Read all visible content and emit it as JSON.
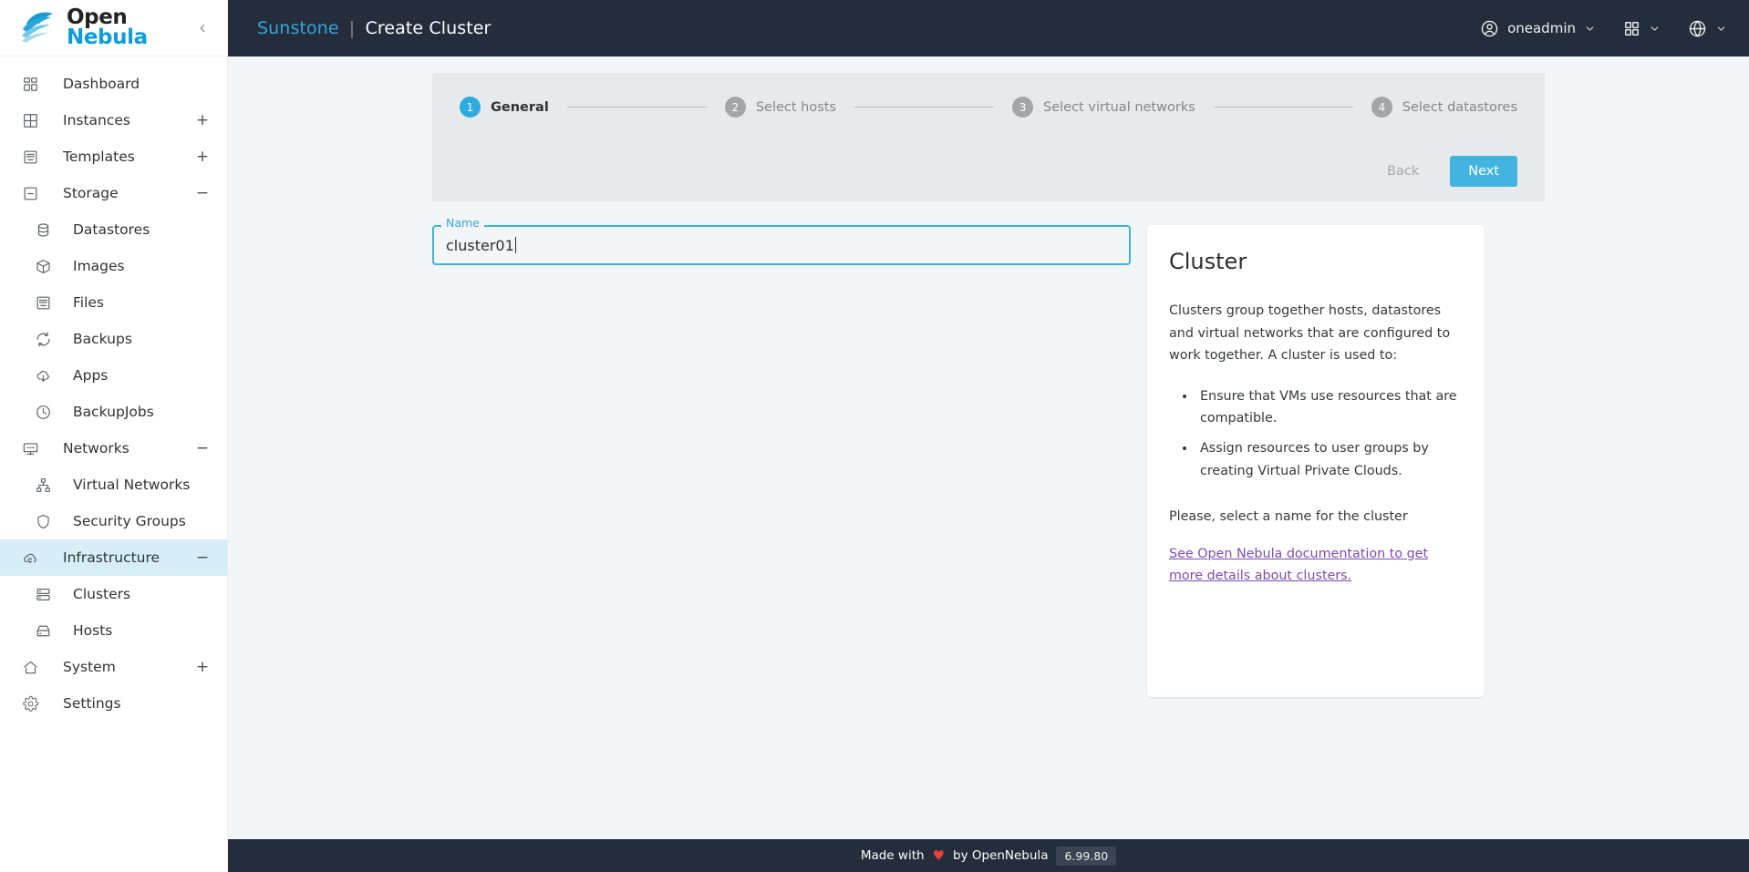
{
  "brand": {
    "name_line1": "Open",
    "name_line2": "Nebula",
    "logo_icon": "opennebula-cloud-logo",
    "collapse_icon": "chevron-left-icon"
  },
  "sidebar": {
    "items": [
      {
        "label": "Dashboard",
        "icon": "dashboard-grid-icon",
        "level": "root",
        "toggle": "",
        "active": false
      },
      {
        "label": "Instances",
        "icon": "instances-grid-icon",
        "level": "root",
        "toggle": "+",
        "active": false
      },
      {
        "label": "Templates",
        "icon": "templates-icon",
        "level": "root",
        "toggle": "+",
        "active": false
      },
      {
        "label": "Storage",
        "icon": "storage-icon",
        "level": "root",
        "toggle": "−",
        "active": false
      },
      {
        "label": "Datastores",
        "icon": "datastore-icon",
        "level": "child",
        "toggle": "",
        "active": false
      },
      {
        "label": "Images",
        "icon": "image-box-icon",
        "level": "child",
        "toggle": "",
        "active": false
      },
      {
        "label": "Files",
        "icon": "files-icon",
        "level": "child",
        "toggle": "",
        "active": false
      },
      {
        "label": "Backups",
        "icon": "backup-refresh-icon",
        "level": "child",
        "toggle": "",
        "active": false
      },
      {
        "label": "Apps",
        "icon": "apps-cloud-download-icon",
        "level": "child",
        "toggle": "",
        "active": false
      },
      {
        "label": "BackupJobs",
        "icon": "clock-icon",
        "level": "child",
        "toggle": "",
        "active": false
      },
      {
        "label": "Networks",
        "icon": "networks-monitor-icon",
        "level": "root",
        "toggle": "−",
        "active": false
      },
      {
        "label": "Virtual Networks",
        "icon": "network-tree-icon",
        "level": "child",
        "toggle": "",
        "active": false
      },
      {
        "label": "Security Groups",
        "icon": "shield-icon",
        "level": "child",
        "toggle": "",
        "active": false
      },
      {
        "label": "Infrastructure",
        "icon": "infrastructure-cloud-icon",
        "level": "root",
        "toggle": "−",
        "active": true
      },
      {
        "label": "Clusters",
        "icon": "clusters-servers-icon",
        "level": "child",
        "toggle": "",
        "active": false
      },
      {
        "label": "Hosts",
        "icon": "host-server-icon",
        "level": "child",
        "toggle": "",
        "active": false
      },
      {
        "label": "System",
        "icon": "system-home-icon",
        "level": "root",
        "toggle": "+",
        "active": false
      },
      {
        "label": "Settings",
        "icon": "gear-icon",
        "level": "root",
        "toggle": "",
        "active": false
      }
    ]
  },
  "topbar": {
    "app_name": "Sunstone",
    "separator": "|",
    "page_title": "Create Cluster",
    "user": {
      "label": "oneadmin",
      "icon": "user-circle-icon",
      "chevron": "chevron-down-icon"
    },
    "views": {
      "icon": "grid-apps-icon",
      "chevron": "chevron-down-icon"
    },
    "language": {
      "icon": "globe-icon",
      "chevron": "chevron-down-icon"
    }
  },
  "stepper": {
    "steps": [
      {
        "number": "1",
        "label": "General",
        "active": true
      },
      {
        "number": "2",
        "label": "Select hosts",
        "active": false
      },
      {
        "number": "3",
        "label": "Select virtual networks",
        "active": false
      },
      {
        "number": "4",
        "label": "Select datastores",
        "active": false
      }
    ],
    "back_label": "Back",
    "next_label": "Next"
  },
  "form": {
    "name_field": {
      "legend": "Name",
      "value": "cluster01",
      "placeholder": ""
    }
  },
  "info_card": {
    "title": "Cluster",
    "intro": "Clusters group together hosts, datastores and virtual networks that are configured to work together. A cluster is used to:",
    "bullets": [
      "Ensure that VMs use resources that are compatible.",
      "Assign resources to user groups by creating Virtual Private Clouds."
    ],
    "note": "Please, select a name for the cluster",
    "link": "See Open Nebula documentation to get more details about clusters."
  },
  "footer": {
    "made_with": "Made with",
    "heart": "♥",
    "by": "by OpenNebula",
    "version": "6.99.80"
  },
  "colors": {
    "accent": "#43b4e0",
    "sunstone_cyan": "#31a8dd",
    "topbar_bg": "#252c3b",
    "page_bg": "#f3f5f7",
    "stepper_bg": "#e7eaec",
    "active_nav_bg": "#d7eef8",
    "link_purple": "#7a4cb3",
    "heart_red": "#e8403a"
  }
}
